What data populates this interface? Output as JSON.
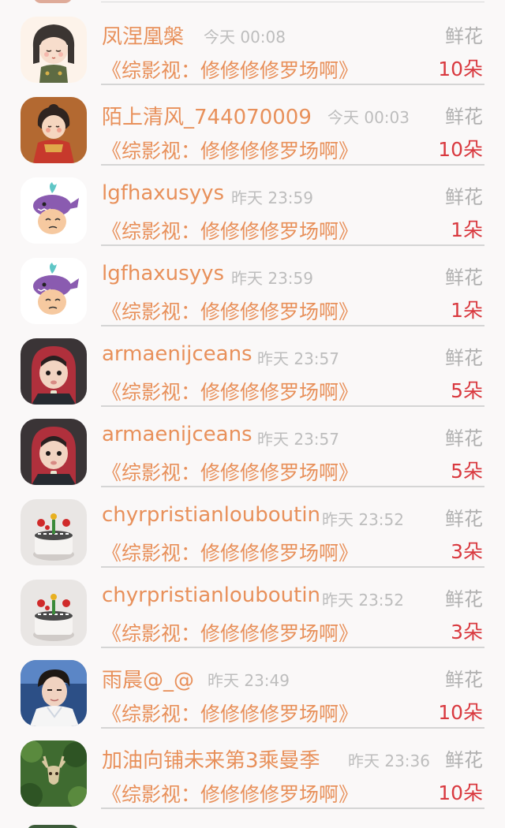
{
  "gift_list": {
    "rows": [
      {
        "user": "凤涅凰槃",
        "time": "今天 00:08",
        "gift": "鲜花",
        "book": "《综影视：修修修修罗场啊》",
        "count": "10朵",
        "avatar": "girl-cartoon-avatar"
      },
      {
        "user": "陌上清风_744070009",
        "time": "今天 00:03",
        "gift": "鲜花",
        "book": "《综影视：修修修修罗场啊》",
        "count": "10朵",
        "avatar": "red-robe-cartoon-avatar"
      },
      {
        "user": "lgfhaxusyys",
        "time": "昨天 23:59",
        "gift": "鲜花",
        "book": "《综影视：修修修修罗场啊》",
        "count": "1朵",
        "avatar": "whale-hat-avatar"
      },
      {
        "user": "lgfhaxusyys",
        "time": "昨天 23:59",
        "gift": "鲜花",
        "book": "《综影视：修修修修罗场啊》",
        "count": "1朵",
        "avatar": "whale-hat-avatar"
      },
      {
        "user": "armaenijceans",
        "time": "昨天 23:57",
        "gift": "鲜花",
        "book": "《综影视：修修修修罗场啊》",
        "count": "5朵",
        "avatar": "child-photo-avatar"
      },
      {
        "user": "armaenijceans",
        "time": "昨天 23:57",
        "gift": "鲜花",
        "book": "《综影视：修修修修罗场啊》",
        "count": "5朵",
        "avatar": "child-photo-avatar"
      },
      {
        "user": "chyrpristianlouboutin",
        "time": "昨天 23:52",
        "gift": "鲜花",
        "book": "《综影视：修修修修罗场啊》",
        "count": "3朵",
        "avatar": "cake-photo-avatar"
      },
      {
        "user": "chyrpristianlouboutin",
        "time": "昨天 23:52",
        "gift": "鲜花",
        "book": "《综影视：修修修修罗场啊》",
        "count": "3朵",
        "avatar": "cake-photo-avatar"
      },
      {
        "user": "雨晨@_@",
        "time": "昨天 23:49",
        "gift": "鲜花",
        "book": "《综影视：修修修修罗场啊》",
        "count": "10朵",
        "avatar": "young-man-photo-avatar"
      },
      {
        "user": "加油向铺未来第3乘曼季",
        "time": "昨天 23:36",
        "gift": "鲜花",
        "book": "《综影视：修修修修罗场啊》",
        "count": "10朵",
        "avatar": "deer-forest-avatar"
      }
    ]
  }
}
